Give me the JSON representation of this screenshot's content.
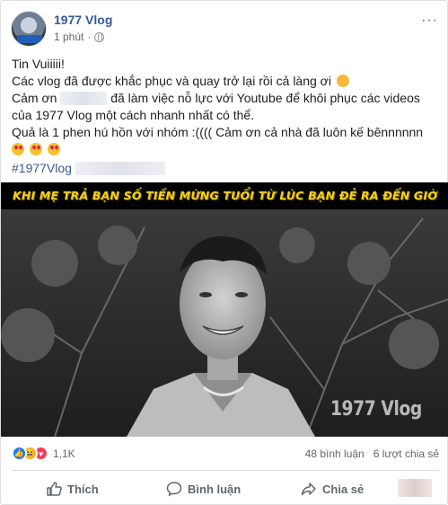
{
  "post": {
    "page_name": "1977 Vlog",
    "time": "1 phút",
    "audience_icon": "globe-icon",
    "more_icon": "more-dots-icon"
  },
  "body": {
    "line1": "Tin Vuiiiii!",
    "line2": "Các vlog đã được khắc phục và quay trở lại rồi cả làng ơi",
    "line3_start": "Cảm ơn",
    "line3_end": "đã làm việc nỗ lực với Youtube để khôi phục các videos",
    "line4": "của 1977 Vlog một cách nhanh nhất có thể.",
    "line5": "Quả là 1 phen hú hồn với nhóm :(((( Cảm ơn cả nhà đã luôn kế bênnnnnn",
    "hashtag": "#1977Vlog"
  },
  "media": {
    "caption": "KHI MẸ TRẢ BẠN SỐ TIỀN MỪNG TUỔI TỪ LÚC BẠN ĐẺ RA ĐẾN GIỜ",
    "watermark": "1977 Vlog"
  },
  "stats": {
    "reaction_count": "1,1K",
    "comments": "48 bình luận",
    "shares": "6 lượt chia sẻ"
  },
  "actions": {
    "like": "Thích",
    "comment": "Bình luận",
    "share": "Chia sẻ"
  },
  "colors": {
    "link": "#365899",
    "caption": "#f2d21a",
    "like": "#1877f2",
    "love": "#f33e58",
    "haha": "#f7b125"
  }
}
